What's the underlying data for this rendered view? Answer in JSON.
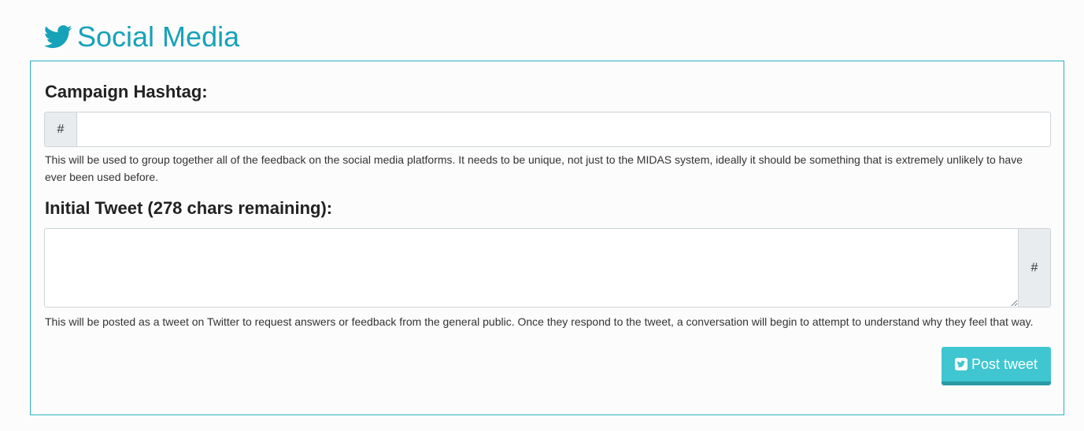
{
  "header": {
    "icon": "twitter-bird-icon",
    "title": "Social Media",
    "accent_color": "#16a2b8"
  },
  "hashtag": {
    "label": "Campaign Hashtag:",
    "addon": "#",
    "value": "",
    "help": "This will be used to group together all of the feedback on the social media platforms. It needs to be unique, not just to the MIDAS system, ideally it should be something that is extremely unlikely to have ever been used before."
  },
  "tweet": {
    "label": "Initial Tweet (278 chars remaining):",
    "addon": "#",
    "value": "",
    "help": "This will be posted as a tweet on Twitter to request answers or feedback from the general public. Once they respond to the tweet, a conversation will begin to attempt to understand why they feel that way."
  },
  "post_button": {
    "icon": "twitter-square-icon",
    "label": "Post tweet",
    "color": "#3fc6d0"
  }
}
